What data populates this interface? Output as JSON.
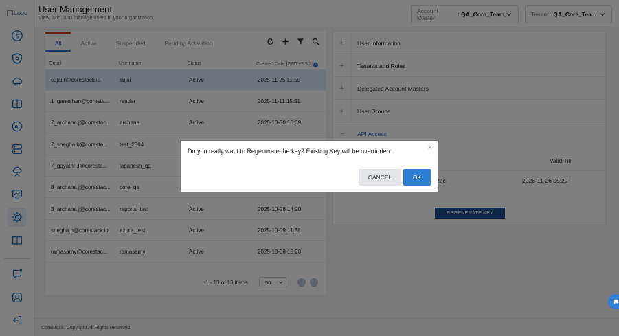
{
  "sidebar": {
    "logo_alt": "Logo",
    "icons": [
      "dollar-icon",
      "shield-icon",
      "cloud-icon",
      "compare-icon",
      "ai-icon",
      "server-icon",
      "cloud-network-icon",
      "monitor-chart-icon",
      "gear-icon",
      "book-icon",
      "chat-icon",
      "user-icon",
      "logout-icon"
    ]
  },
  "header": {
    "title": "User Management",
    "subtitle": "View, add, and manage users in your organization.",
    "account_master_label": "Account Master",
    "account_master_value": ": QA_Core_Team_",
    "tenant_label": "Tenant :",
    "tenant_value": "QA_Core_Tea..."
  },
  "tabs": [
    "All",
    "Active",
    "Suspended",
    "Pending Activation"
  ],
  "toolbar_icons": [
    "refresh-icon",
    "add-icon",
    "filter-icon",
    "search-icon"
  ],
  "table": {
    "columns": [
      "Email",
      "Username",
      "Status",
      "Created Date [GMT+5:30]"
    ],
    "rows": [
      {
        "email": "sujai.r@corestack.io",
        "username": "sujai",
        "status": "Active",
        "created": "2025-11-25 11:59"
      },
      {
        "email": "1_ganeshan@coresta...",
        "username": "reader",
        "status": "Active",
        "created": "2025-11-11 15:51"
      },
      {
        "email": "7_archana.j@corestac...",
        "username": "archana",
        "status": "Active",
        "created": "2025-10-30 16:39"
      },
      {
        "email": "7_snegha.b@coresta...",
        "username": "test_2504",
        "status": "",
        "created": ""
      },
      {
        "email": "7_gayathri.l@coresta...",
        "username": "japanesh_qa",
        "status": "",
        "created": ""
      },
      {
        "email": "8_archana.j@corestac...",
        "username": "core_qa",
        "status": "",
        "created": ""
      },
      {
        "email": "3_archana.j@corestac...",
        "username": "reports_test",
        "status": "Active",
        "created": "2025-10-28 14:20"
      },
      {
        "email": "snegha.b@corestack.io",
        "username": "azure_test",
        "status": "Active",
        "created": "2025-10-09 11:38"
      },
      {
        "email": "ramasamy@corestac...",
        "username": "ramasamy",
        "status": "Active",
        "created": "2025-10-08 18:20"
      }
    ]
  },
  "pager": {
    "info": "1 - 13 of 13 items",
    "page_size": "50"
  },
  "details": {
    "sections": [
      "User Information",
      "Tenants and Roles",
      "Delegated Account Masters",
      "User Groups",
      "API Access"
    ],
    "api_valid_till_label": "Valid Till",
    "api_key_fragment": "2bc",
    "api_valid_till_value": "2026-11-26 05:29",
    "regenerate_label": "REGENERATE KEY"
  },
  "modal": {
    "message": "Do you really want to Regenerate the key? Existing Key will be overridden.",
    "cancel_label": "CANCEL",
    "ok_label": "OK"
  },
  "footer": {
    "copyright": "CoreStack. Copyright All Rights Reserved"
  },
  "colors": {
    "accent": "#2f7fd6",
    "primary_dark": "#1f4f8f",
    "tab_red": "#d23a2a",
    "selected_row": "#dde9f7"
  }
}
